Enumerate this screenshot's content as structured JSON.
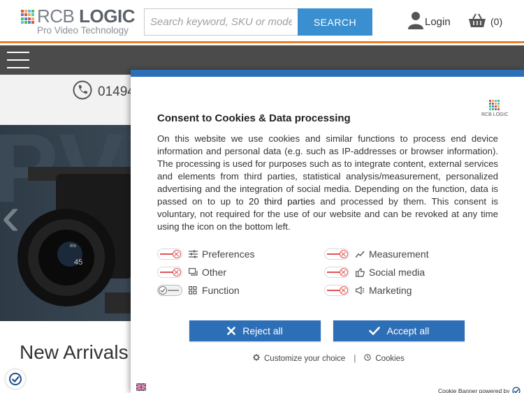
{
  "brand": {
    "logo_main": "RCB",
    "logo_bold": "LOGIC",
    "logo_sub": "Pro Video Technology",
    "accent_color": "#f07c22",
    "primary_color": "#3a8fd0"
  },
  "header": {
    "search_placeholder": "Search keyword, SKU or mode",
    "search_label": "SEARCH",
    "login_label": "Login",
    "cart_count": "(0)"
  },
  "phone_strip": {
    "phone_partial": "01494"
  },
  "main": {
    "section_title": "New Arrivals"
  },
  "consent": {
    "title": "Consent to Cookies & Data processing",
    "logo_text": "RCB LOGIC",
    "body_before": "On this website we use cookies and similar functions to process end device information and personal data (e.g. such as IP-addresses or browser information). The processing is used for purposes such as to integrate content, external services and elements from third parties, statistical analysis/measurement, personalized advertising and the integration of social media. Depending on the function, data is passed on to up to ",
    "body_highlight": "20 third parties",
    "body_after": " and processed by them. This consent is voluntary, not required for the use of our website and can be revoked at any time using the icon on the bottom left.",
    "categories": [
      {
        "label": "Preferences",
        "icon": "sliders-icon",
        "enabled": false
      },
      {
        "label": "Measurement",
        "icon": "chart-line-icon",
        "enabled": false
      },
      {
        "label": "Other",
        "icon": "chat-icon",
        "enabled": false
      },
      {
        "label": "Social media",
        "icon": "thumbs-up-icon",
        "enabled": false
      },
      {
        "label": "Function",
        "icon": "grid-icon",
        "enabled": true
      },
      {
        "label": "Marketing",
        "icon": "megaphone-icon",
        "enabled": false
      }
    ],
    "reject_label": "Reject all",
    "accept_label": "Accept all",
    "customize_label": "Customize your choice",
    "separator": "|",
    "cookies_label": "Cookies",
    "powered_by": "Cookie Banner powered by"
  }
}
